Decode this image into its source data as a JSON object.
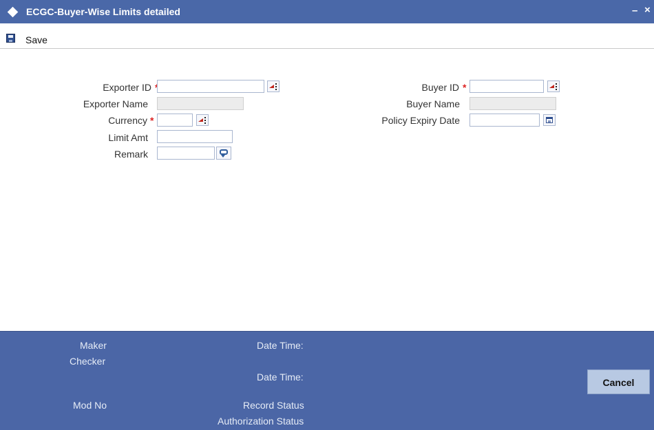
{
  "window": {
    "title": "ECGC-Buyer-Wise Limits detailed",
    "minimize": "–",
    "close": "×"
  },
  "toolbar": {
    "save_label": "Save"
  },
  "form": {
    "exporter_id": {
      "label": "Exporter ID",
      "required_mark": "*",
      "value": ""
    },
    "exporter_name": {
      "label": "Exporter Name",
      "value": ""
    },
    "currency": {
      "label": "Currency",
      "required_mark": "*",
      "value": ""
    },
    "limit_amt": {
      "label": "Limit Amt",
      "value": ""
    },
    "remark": {
      "label": "Remark",
      "value": ""
    },
    "buyer_id": {
      "label": "Buyer ID",
      "required_mark": "*",
      "value": ""
    },
    "buyer_name": {
      "label": "Buyer Name",
      "value": ""
    },
    "policy_expiry_date": {
      "label": "Policy Expiry Date",
      "value": ""
    }
  },
  "footer": {
    "maker": "Maker",
    "checker": "Checker",
    "mod_no": "Mod No",
    "date_time_1": "Date Time:",
    "date_time_2": "Date Time:",
    "record_status": "Record Status",
    "authorization_status": "Authorization Status",
    "cancel_label": "Cancel"
  },
  "colors": {
    "header_bg": "#4a68a8",
    "footer_bg": "#4b66a6",
    "cancel_bg": "#b8c9e3",
    "required": "#dd2222"
  }
}
